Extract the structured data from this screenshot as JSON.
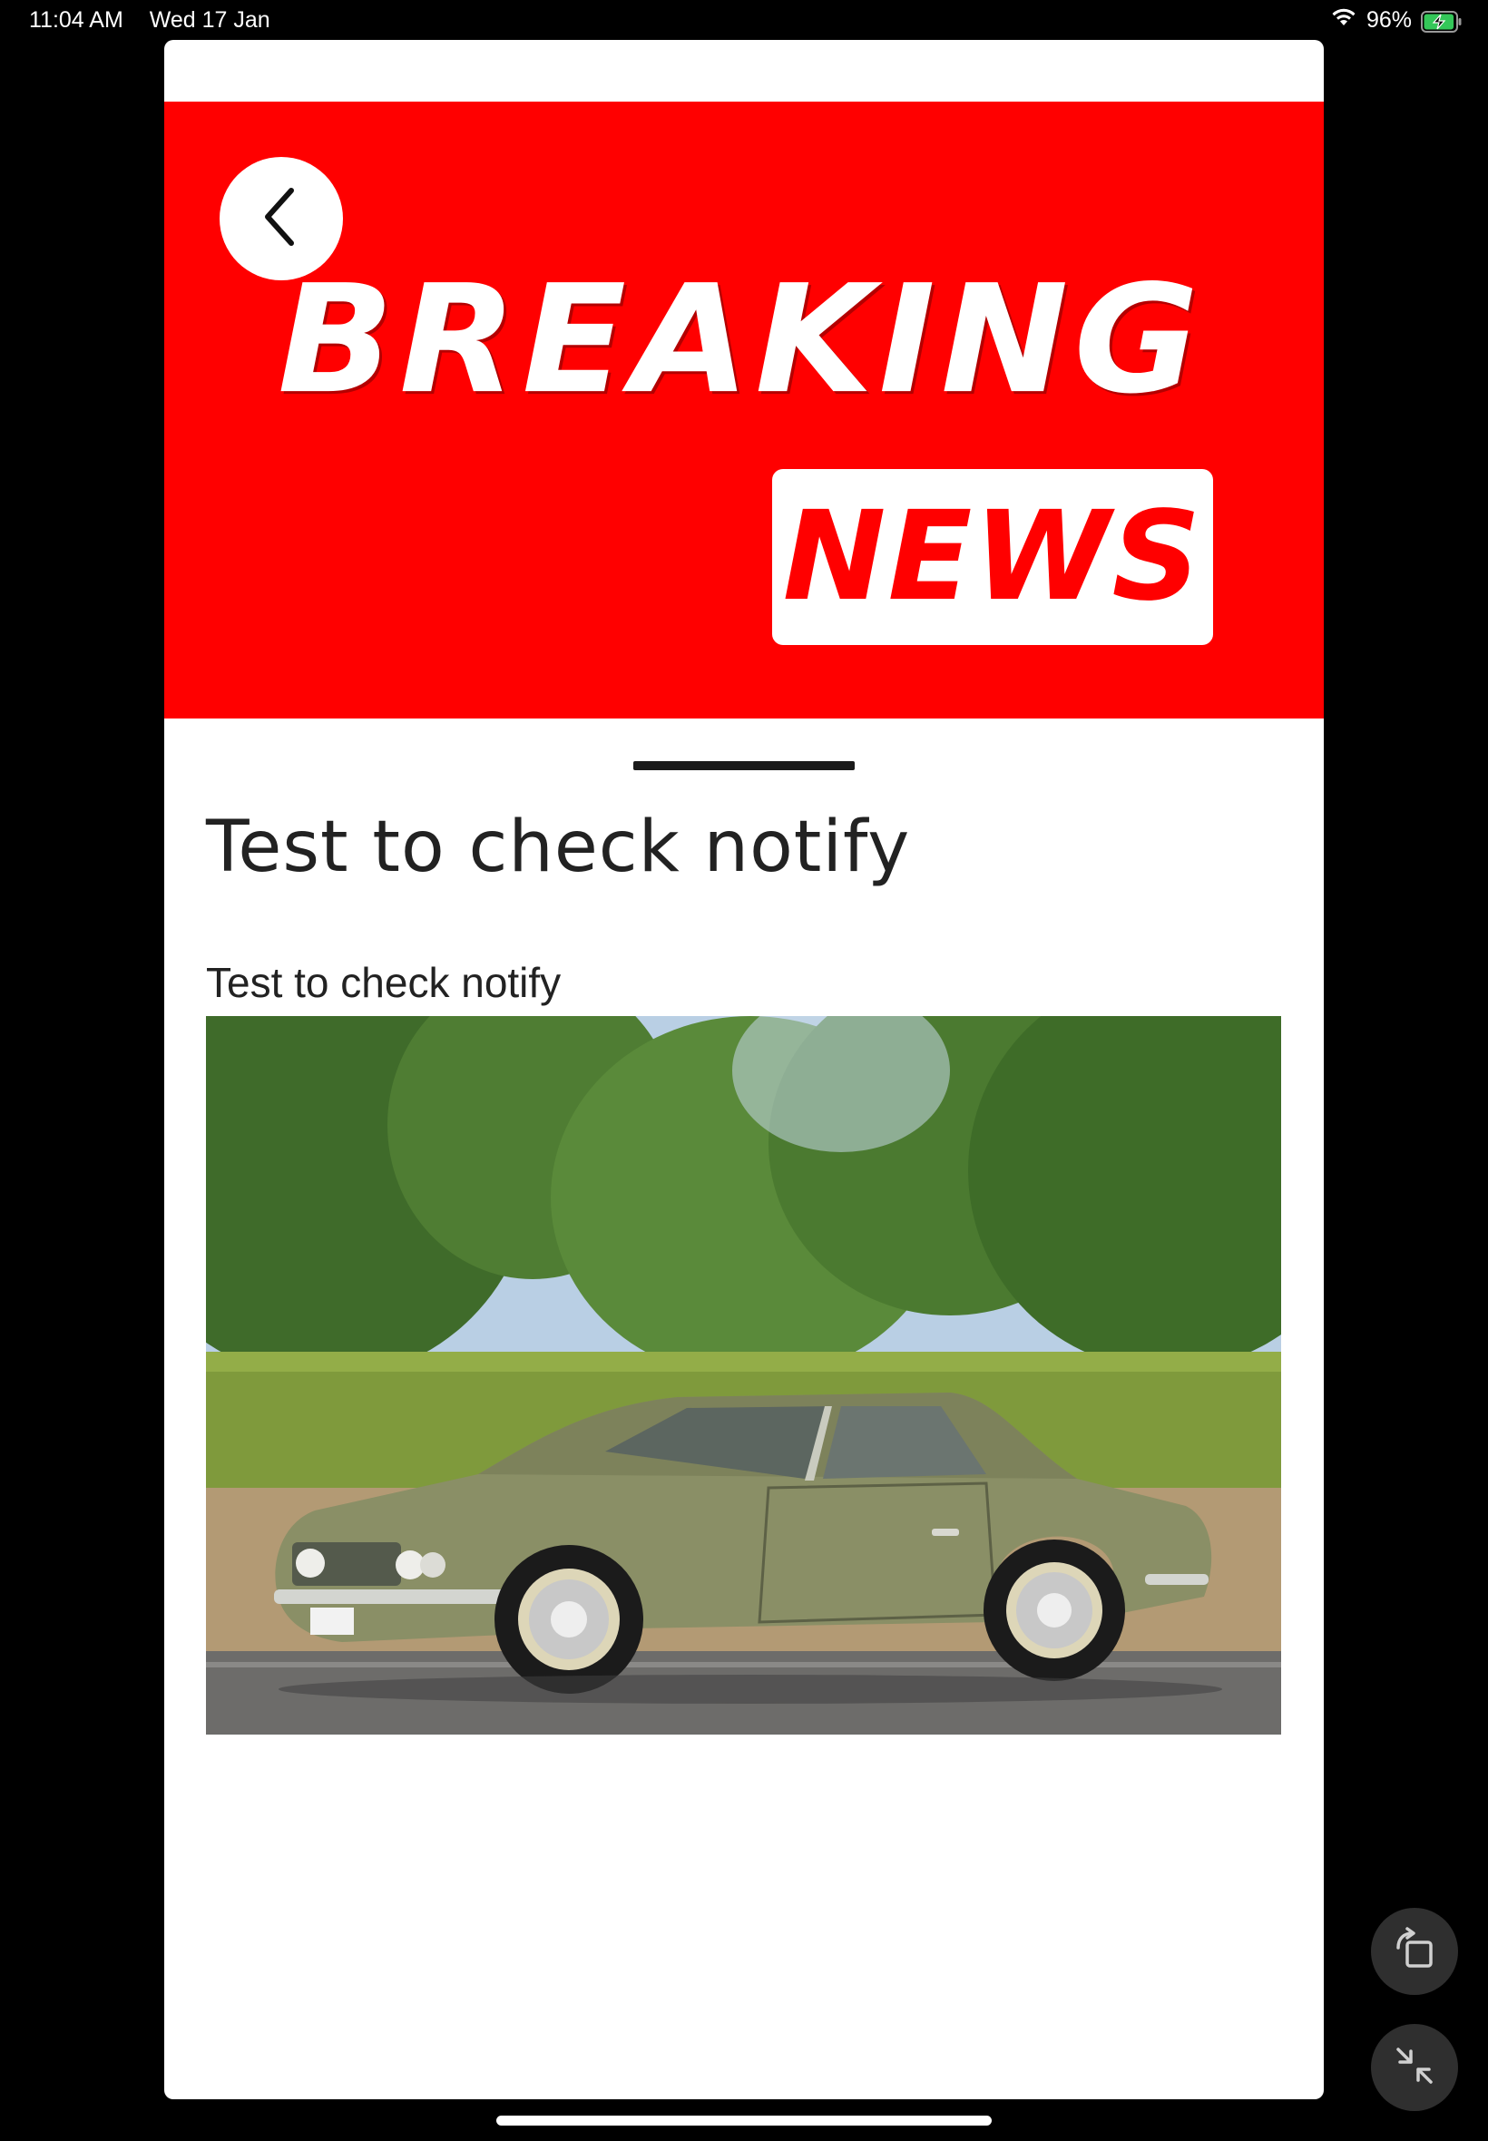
{
  "status_bar": {
    "time": "11:04 AM",
    "date": "Wed 17 Jan",
    "battery_percent": "96%",
    "battery_level": 0.96,
    "charging": true,
    "battery_color": "#34c759"
  },
  "banner": {
    "headline_top": "BREAKING",
    "headline_bottom": "NEWS",
    "background_color": "#ff0000",
    "back_icon": "chevron-left-icon"
  },
  "article": {
    "title": "Test to check notify",
    "body": "Test to check notify",
    "image_icon": "car-photo"
  },
  "floating_controls": {
    "rotate_icon": "rotate-screen-icon",
    "minimize_icon": "minimize-arrows-icon"
  }
}
